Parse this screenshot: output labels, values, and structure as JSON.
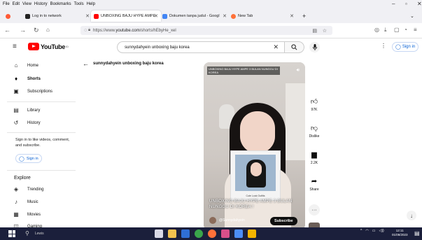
{
  "menubar": {
    "items": [
      "File",
      "Edit",
      "View",
      "History",
      "Bookmarks",
      "Tools",
      "Help"
    ]
  },
  "tabs": [
    {
      "label": "Log in to network",
      "color": "#222222"
    },
    {
      "label": "UNBOXING BAJU HYPE AMPE",
      "color": "#ff0000"
    },
    {
      "label": "Dokumen tanpa judul - Googl",
      "color": "#4285f4"
    },
    {
      "label": "New Tab",
      "color": "#ff7139"
    }
  ],
  "navbar": {
    "url_prefix": "https://www.",
    "url_host": "youtube.com",
    "url_path": "/shorts/hEbyHe_xel"
  },
  "youtube": {
    "logo_text": "YouTube",
    "logo_sup": "ID",
    "search_query": "sunnydahyein unboxing baju korea",
    "signin_label": "Sign in",
    "brand_color": "#ff0000"
  },
  "sidebar": {
    "items": [
      {
        "label": "Home",
        "icon": "home-icon"
      },
      {
        "label": "Shorts",
        "icon": "shorts-icon"
      },
      {
        "label": "Subscriptions",
        "icon": "subscriptions-icon"
      },
      {
        "label": "Library",
        "icon": "library-icon"
      },
      {
        "label": "History",
        "icon": "history-icon"
      }
    ],
    "signin_note": "Sign in to like videos, comment, and subscribe.",
    "signin_label": "Sign in",
    "explore_heading": "Explore",
    "explore_items": [
      {
        "label": "Trending",
        "icon": "trending-icon"
      },
      {
        "label": "Music",
        "icon": "music-icon"
      },
      {
        "label": "Movies",
        "icon": "movies-icon"
      },
      {
        "label": "Gaming",
        "icon": "gaming-icon"
      }
    ]
  },
  "main": {
    "back_title": "sunnydahyein unboxing baju korea"
  },
  "short": {
    "overlay_title": "UNBOXING BAJU HYPE AMPE 3 BULAN NUNGGU DI KOREA",
    "pip_caption": "Cute Look Outfits",
    "caption": "UNBOXING BAJU HYPE AMPE 3 BULAN NUNGGU DI KOREA !",
    "channel": "@Sunnydahyein",
    "subscribe_label": "Subscribe",
    "likes": "97K",
    "dislike_label": "Dislike",
    "comments": "2.2K",
    "share_label": "Share"
  },
  "taskbar": {
    "search_label": "Lewis",
    "time": "12:11",
    "date": "01/08/2023"
  }
}
